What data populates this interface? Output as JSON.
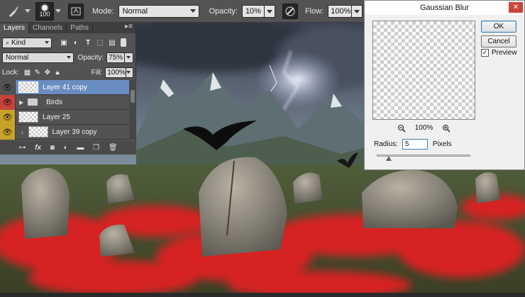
{
  "options_bar": {
    "brush_size": "100",
    "mode_label": "Mode:",
    "mode_value": "Normal",
    "opacity_label": "Opacity:",
    "opacity_value": "10%",
    "flow_label": "Flow:",
    "flow_value": "100%"
  },
  "layers_panel": {
    "tabs": [
      {
        "label": "Layers"
      },
      {
        "label": "Channels"
      },
      {
        "label": "Paths"
      }
    ],
    "menu_glyph": "▸≡",
    "filter_value": "Kind",
    "blend_mode": "Normal",
    "opacity_label": "Opacity:",
    "opacity_value": "75%",
    "lock_label": "Lock:",
    "fill_label": "Fill:",
    "fill_value": "100%",
    "layers": [
      {
        "name": "Layer 41 copy",
        "selected": true,
        "eye_color": "#535353"
      },
      {
        "name": "Birds",
        "type": "group",
        "eye_color": "#c8423a"
      },
      {
        "name": "Layer 25",
        "eye_color": "#c8a32a"
      },
      {
        "name": "Layer 39 copy",
        "clipped": true,
        "eye_color": "#c8a32a"
      }
    ],
    "footer_icons": [
      "link-icon",
      "fx-icon",
      "mask-icon",
      "adjustment-icon",
      "folder-icon",
      "new-layer-icon",
      "trash-icon"
    ]
  },
  "gaussian_blur": {
    "title": "Gaussian Blur",
    "ok_label": "OK",
    "cancel_label": "Cancel",
    "preview_label": "Preview",
    "preview_checked": true,
    "zoom_value": "100%",
    "radius_label": "Radius:",
    "radius_value": "5",
    "radius_unit": "Pixels",
    "close_glyph": "✕"
  },
  "colors": {
    "panel_bg": "#535353",
    "selected_layer": "#6a8dc1",
    "poppy_red": "#d62222",
    "close_red": "#c9463d"
  }
}
